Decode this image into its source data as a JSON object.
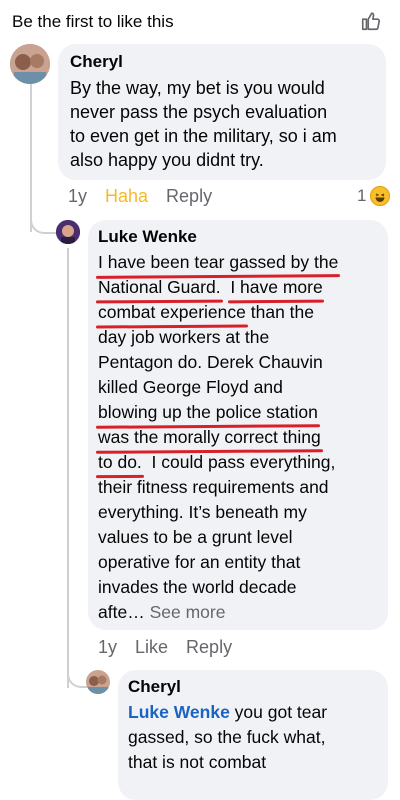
{
  "header": {
    "text": "Be the first to like this",
    "icon": "thumbs-up-outline-icon"
  },
  "comment1": {
    "author": "Cheryl",
    "lines": [
      "By the way, my bet is you would",
      "never pass the psych evaluation",
      "to even get in the military, so i am",
      "also happy you didnt try."
    ],
    "time": "1y",
    "reaction_label": "Haha",
    "reply_label": "Reply",
    "reaction_count": "1",
    "reaction_icon": "haha-emoji-icon"
  },
  "comment2": {
    "author": "Luke Wenke",
    "lines": {
      "l1": "I have been tear gassed by the",
      "l2a": "National Guard.",
      "l2b": "I have more",
      "l3a": "combat experience",
      "l3b": " than the",
      "l4": "day job workers at the",
      "l5": "Pentagon do.  Derek Chauvin",
      "l6": "killed George Floyd and",
      "l7": "blowing up the police station",
      "l8": "was the morally correct thing",
      "l9a": "to do.",
      "l9b": "  I could pass everything,",
      "l10": "their fitness requirements and",
      "l11": "everything.  It’s beneath my",
      "l12": "values to be a grunt level",
      "l13": "operative for an entity that",
      "l14": "invades the world decade",
      "l15": "afte…",
      "see_more": "See more"
    },
    "time": "1y",
    "like_label": "Like",
    "reply_label": "Reply"
  },
  "comment3": {
    "author": "Cheryl",
    "mention": "Luke Wenke",
    "line1_rest": " you got tear",
    "line2": "gassed, so the fuck what,",
    "line3": "that is not combat"
  },
  "colors": {
    "bubble": "#f0f2f5",
    "underline": "#d8202a",
    "mention": "#1b64c4",
    "haha": "#f7b928",
    "meta": "#65676b"
  }
}
